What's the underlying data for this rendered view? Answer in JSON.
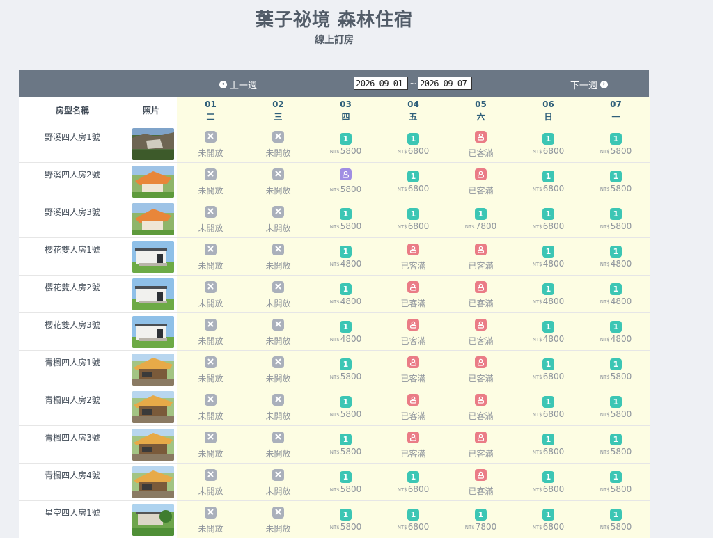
{
  "header": {
    "title": "葉子祕境 森林住宿",
    "subtitle": "線上訂房"
  },
  "nav": {
    "prev_label": "上一週",
    "next_label": "下一週",
    "date_from": "2026-09-01",
    "date_to": "2026-09-07",
    "range_sep": "~"
  },
  "columns": {
    "name": "房型名稱",
    "photo": "照片"
  },
  "days": [
    {
      "date": "01",
      "weekday": "二"
    },
    {
      "date": "02",
      "weekday": "三"
    },
    {
      "date": "03",
      "weekday": "四"
    },
    {
      "date": "04",
      "weekday": "五"
    },
    {
      "date": "05",
      "weekday": "六"
    },
    {
      "date": "06",
      "weekday": "日"
    },
    {
      "date": "07",
      "weekday": "一"
    }
  ],
  "labels": {
    "closed": "未開放",
    "full": "已客滿",
    "available_count": "1",
    "currency": "NT$"
  },
  "colors": {
    "closed": "#aab0bb",
    "available": "#3cc6b4",
    "full": "#ea7c86",
    "my_booking": "#a08ee3",
    "navbar": "#6b7785",
    "day_bg": "#fdfde3"
  },
  "rooms": [
    {
      "name": "野溪四人房1號",
      "photo": "cliff",
      "cells": [
        {
          "s": "closed"
        },
        {
          "s": "closed"
        },
        {
          "s": "avail",
          "p": "5800"
        },
        {
          "s": "avail",
          "p": "6800"
        },
        {
          "s": "full"
        },
        {
          "s": "avail",
          "p": "6800"
        },
        {
          "s": "avail",
          "p": "5800"
        }
      ]
    },
    {
      "name": "野溪四人房2號",
      "photo": "tent",
      "cells": [
        {
          "s": "closed"
        },
        {
          "s": "closed"
        },
        {
          "s": "user",
          "p": "5800"
        },
        {
          "s": "avail",
          "p": "6800"
        },
        {
          "s": "full"
        },
        {
          "s": "avail",
          "p": "6800"
        },
        {
          "s": "avail",
          "p": "5800"
        }
      ]
    },
    {
      "name": "野溪四人房3號",
      "photo": "tent",
      "cells": [
        {
          "s": "closed"
        },
        {
          "s": "closed"
        },
        {
          "s": "avail",
          "p": "5800"
        },
        {
          "s": "avail",
          "p": "6800"
        },
        {
          "s": "avail",
          "p": "7800"
        },
        {
          "s": "avail",
          "p": "6800"
        },
        {
          "s": "avail",
          "p": "5800"
        }
      ]
    },
    {
      "name": "櫻花雙人房1號",
      "photo": "cabin",
      "cells": [
        {
          "s": "closed"
        },
        {
          "s": "closed"
        },
        {
          "s": "avail",
          "p": "4800"
        },
        {
          "s": "full"
        },
        {
          "s": "full"
        },
        {
          "s": "avail",
          "p": "4800"
        },
        {
          "s": "avail",
          "p": "4800"
        }
      ]
    },
    {
      "name": "櫻花雙人房2號",
      "photo": "cabin",
      "cells": [
        {
          "s": "closed"
        },
        {
          "s": "closed"
        },
        {
          "s": "avail",
          "p": "4800"
        },
        {
          "s": "full"
        },
        {
          "s": "full"
        },
        {
          "s": "avail",
          "p": "4800"
        },
        {
          "s": "avail",
          "p": "4800"
        }
      ]
    },
    {
      "name": "櫻花雙人房3號",
      "photo": "cabin",
      "cells": [
        {
          "s": "closed"
        },
        {
          "s": "closed"
        },
        {
          "s": "avail",
          "p": "4800"
        },
        {
          "s": "full"
        },
        {
          "s": "full"
        },
        {
          "s": "avail",
          "p": "4800"
        },
        {
          "s": "avail",
          "p": "4800"
        }
      ]
    },
    {
      "name": "青楓四人房1號",
      "photo": "canopy",
      "cells": [
        {
          "s": "closed"
        },
        {
          "s": "closed"
        },
        {
          "s": "avail",
          "p": "5800"
        },
        {
          "s": "full"
        },
        {
          "s": "full"
        },
        {
          "s": "avail",
          "p": "6800"
        },
        {
          "s": "avail",
          "p": "5800"
        }
      ]
    },
    {
      "name": "青楓四人房2號",
      "photo": "canopy",
      "cells": [
        {
          "s": "closed"
        },
        {
          "s": "closed"
        },
        {
          "s": "avail",
          "p": "5800"
        },
        {
          "s": "full"
        },
        {
          "s": "full"
        },
        {
          "s": "avail",
          "p": "6800"
        },
        {
          "s": "avail",
          "p": "5800"
        }
      ]
    },
    {
      "name": "青楓四人房3號",
      "photo": "canopy",
      "cells": [
        {
          "s": "closed"
        },
        {
          "s": "closed"
        },
        {
          "s": "avail",
          "p": "5800"
        },
        {
          "s": "full"
        },
        {
          "s": "full"
        },
        {
          "s": "avail",
          "p": "6800"
        },
        {
          "s": "avail",
          "p": "5800"
        }
      ]
    },
    {
      "name": "青楓四人房4號",
      "photo": "canopy",
      "cells": [
        {
          "s": "closed"
        },
        {
          "s": "closed"
        },
        {
          "s": "avail",
          "p": "5800"
        },
        {
          "s": "avail",
          "p": "6800"
        },
        {
          "s": "full"
        },
        {
          "s": "avail",
          "p": "6800"
        },
        {
          "s": "avail",
          "p": "5800"
        }
      ]
    },
    {
      "name": "星空四人房1號",
      "photo": "garden",
      "cells": [
        {
          "s": "closed"
        },
        {
          "s": "closed"
        },
        {
          "s": "avail",
          "p": "5800"
        },
        {
          "s": "avail",
          "p": "6800"
        },
        {
          "s": "avail",
          "p": "7800"
        },
        {
          "s": "avail",
          "p": "6800"
        },
        {
          "s": "avail",
          "p": "5800"
        }
      ]
    }
  ]
}
